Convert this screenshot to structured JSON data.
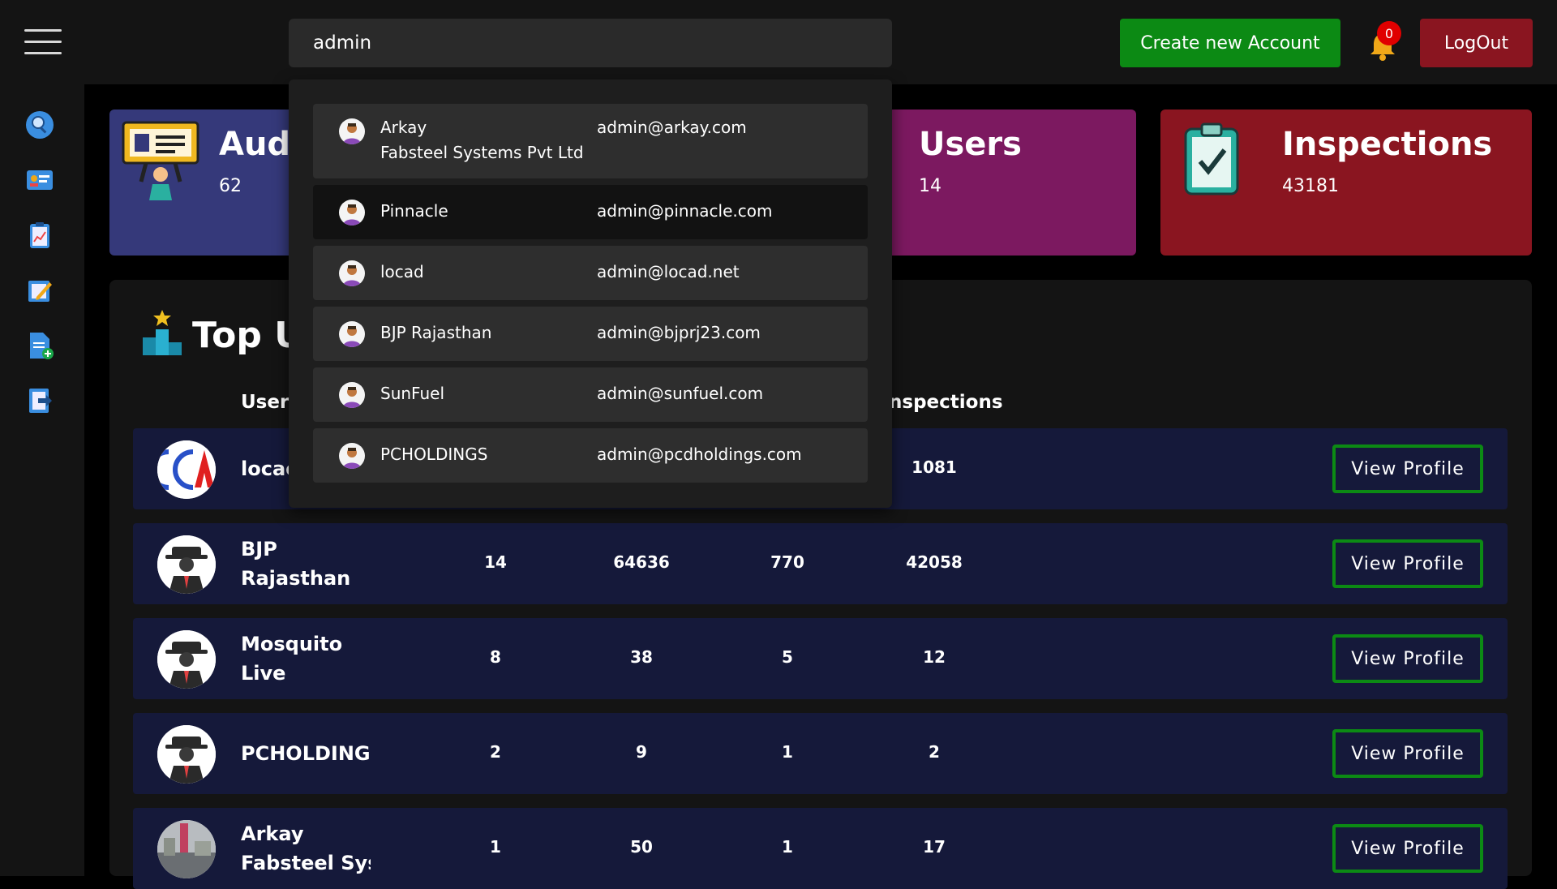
{
  "search": {
    "value": "admin"
  },
  "header": {
    "create_label": "Create new Account",
    "notification_count": "0",
    "logout_label": "LogOut"
  },
  "sidebar": {
    "icons": [
      "search-user-icon",
      "id-card-icon",
      "clipboard-report-icon",
      "edit-icon",
      "add-document-icon",
      "export-document-icon"
    ]
  },
  "cards": {
    "audit": {
      "title": "Audi",
      "value": "62"
    },
    "users": {
      "title": "Users",
      "value": "14"
    },
    "inspections": {
      "title": "Inspections",
      "value": "43181"
    }
  },
  "table": {
    "title": "Top U",
    "headers": {
      "username": "Userr",
      "inspections": "nspections"
    },
    "view_label": "View Profile",
    "rows": [
      {
        "name_line1": "locac",
        "name_line2": "",
        "c1": "",
        "c2": "",
        "c3": "",
        "c4": "1081"
      },
      {
        "name_line1": "BJP",
        "name_line2": "Rajasthan",
        "c1": "14",
        "c2": "64636",
        "c3": "770",
        "c4": "42058"
      },
      {
        "name_line1": "Mosquito",
        "name_line2": "Live",
        "c1": "8",
        "c2": "38",
        "c3": "5",
        "c4": "12"
      },
      {
        "name_line1": "PCHOLDINGS",
        "name_line2": "",
        "c1": "2",
        "c2": "9",
        "c3": "1",
        "c4": "2"
      },
      {
        "name_line1": "Arkay",
        "name_line2": "Fabsteel Syst",
        "c1": "1",
        "c2": "50",
        "c3": "1",
        "c4": "17"
      }
    ]
  },
  "dropdown": {
    "items": [
      {
        "name_line1": "Arkay",
        "name_line2": "Fabsteel Systems Pvt Ltd",
        "email": "admin@arkay.com"
      },
      {
        "name_line1": "Pinnacle",
        "name_line2": "",
        "email": "admin@pinnacle.com"
      },
      {
        "name_line1": "locad",
        "name_line2": "",
        "email": "admin@locad.net"
      },
      {
        "name_line1": "BJP Rajasthan",
        "name_line2": "",
        "email": "admin@bjprj23.com"
      },
      {
        "name_line1": "SunFuel",
        "name_line2": "",
        "email": "admin@sunfuel.com"
      },
      {
        "name_line1": "PCHOLDINGS",
        "name_line2": "",
        "email": "admin@pcdholdings.com"
      }
    ]
  }
}
